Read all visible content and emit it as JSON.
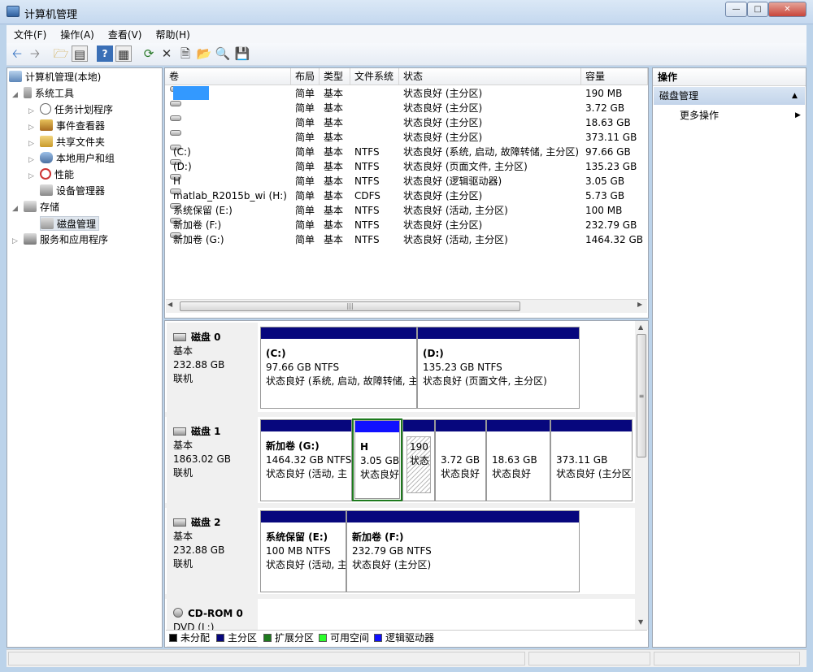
{
  "window": {
    "title": "计算机管理"
  },
  "menu": [
    "文件(F)",
    "操作(A)",
    "查看(V)",
    "帮助(H)"
  ],
  "toolbar_icons": [
    "back-icon",
    "forward-icon",
    "up-folder-icon",
    "show-hide-tree-icon",
    "help-icon",
    "console-icon",
    "refresh-icon",
    "delete-icon",
    "properties-icon",
    "open-icon",
    "search-icon",
    "export-icon"
  ],
  "tree": {
    "root": "计算机管理(本地)",
    "system_tools": "系统工具",
    "task_scheduler": "任务计划程序",
    "event_viewer": "事件查看器",
    "shared_folders": "共享文件夹",
    "local_users": "本地用户和组",
    "performance": "性能",
    "device_manager": "设备管理器",
    "storage": "存储",
    "disk_management": "磁盘管理",
    "services_apps": "服务和应用程序"
  },
  "volume_table": {
    "headers": [
      "卷",
      "布局",
      "类型",
      "文件系统",
      "状态",
      "容量"
    ],
    "rows": [
      {
        "name": "",
        "layout": "简单",
        "type": "基本",
        "fs": "",
        "status": "状态良好 (主分区)",
        "capacity": "190 MB"
      },
      {
        "name": "",
        "layout": "简单",
        "type": "基本",
        "fs": "",
        "status": "状态良好 (主分区)",
        "capacity": "3.72 GB"
      },
      {
        "name": "",
        "layout": "简单",
        "type": "基本",
        "fs": "",
        "status": "状态良好 (主分区)",
        "capacity": "18.63 GB"
      },
      {
        "name": "",
        "layout": "简单",
        "type": "基本",
        "fs": "",
        "status": "状态良好 (主分区)",
        "capacity": "373.11 GB"
      },
      {
        "name": "(C:)",
        "layout": "简单",
        "type": "基本",
        "fs": "NTFS",
        "status": "状态良好 (系统, 启动, 故障转储, 主分区)",
        "capacity": "97.66 GB"
      },
      {
        "name": "(D:)",
        "layout": "简单",
        "type": "基本",
        "fs": "NTFS",
        "status": "状态良好 (页面文件, 主分区)",
        "capacity": "135.23 GB"
      },
      {
        "name": "H",
        "layout": "简单",
        "type": "基本",
        "fs": "NTFS",
        "status": "状态良好 (逻辑驱动器)",
        "capacity": "3.05 GB"
      },
      {
        "name": "matlab_R2015b_wi (H:)",
        "layout": "简单",
        "type": "基本",
        "fs": "CDFS",
        "status": "状态良好 (主分区)",
        "capacity": "5.73 GB"
      },
      {
        "name": "系统保留 (E:)",
        "layout": "简单",
        "type": "基本",
        "fs": "NTFS",
        "status": "状态良好 (活动, 主分区)",
        "capacity": "100 MB"
      },
      {
        "name": "新加卷 (F:)",
        "layout": "简单",
        "type": "基本",
        "fs": "NTFS",
        "status": "状态良好 (主分区)",
        "capacity": "232.79 GB"
      },
      {
        "name": "新加卷 (G:)",
        "layout": "简单",
        "type": "基本",
        "fs": "NTFS",
        "status": "状态良好 (活动, 主分区)",
        "capacity": "1464.32 GB"
      }
    ]
  },
  "disk0": {
    "name": "磁盘 0",
    "type": "基本",
    "size": "232.88 GB",
    "state": "联机",
    "p1": {
      "title": "(C:)",
      "size": "97.66 GB NTFS",
      "status": "状态良好 (系统, 启动, 故障转储, 主"
    },
    "p2": {
      "title": "(D:)",
      "size": "135.23 GB NTFS",
      "status": "状态良好 (页面文件, 主分区)"
    }
  },
  "disk1": {
    "name": "磁盘 1",
    "type": "基本",
    "size": "1863.02 GB",
    "state": "联机",
    "p1": {
      "title": "新加卷  (G:)",
      "size": "1464.32 GB NTFS",
      "status": "状态良好 (活动, 主"
    },
    "p2": {
      "title": "H",
      "size": "3.05 GB",
      "status": "状态良好"
    },
    "p3": {
      "size": "190",
      "status": "状态"
    },
    "p4": {
      "size": "3.72 GB",
      "status": "状态良好"
    },
    "p5": {
      "size": "18.63 GB",
      "status": "状态良好"
    },
    "p6": {
      "size": "373.11 GB",
      "status": "状态良好 (主分区"
    }
  },
  "disk2": {
    "name": "磁盘 2",
    "type": "基本",
    "size": "232.88 GB",
    "state": "联机",
    "p1": {
      "title": "系统保留  (E:)",
      "size": "100 MB NTFS",
      "status": "状态良好 (活动, 主"
    },
    "p2": {
      "title": "新加卷  (F:)",
      "size": "232.79 GB NTFS",
      "status": "状态良好 (主分区)"
    }
  },
  "cdrom": {
    "name": "CD-ROM 0",
    "type": "DVD (L:)"
  },
  "legend": [
    "未分配",
    "主分区",
    "扩展分区",
    "可用空间",
    "逻辑驱动器"
  ],
  "legend_colors": [
    "#000000",
    "#07077d",
    "#1e7a1e",
    "#2bff2b",
    "#1010ff"
  ],
  "actions": {
    "header": "操作",
    "section": "磁盘管理",
    "more": "更多操作"
  }
}
